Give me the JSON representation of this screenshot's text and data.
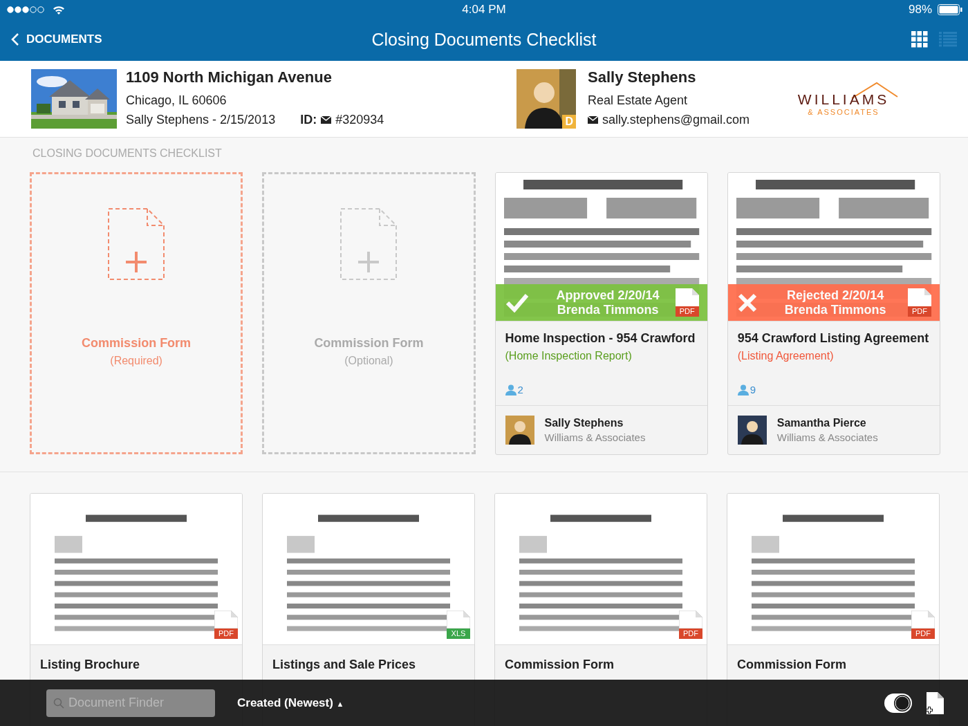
{
  "status_bar": {
    "time": "4:04 PM",
    "battery": "98%"
  },
  "nav": {
    "back": "DOCUMENTS",
    "title": "Closing Documents Checklist",
    "views": [
      {
        "kind": "grid",
        "selected": true
      },
      {
        "kind": "list",
        "selected": false
      }
    ]
  },
  "property": {
    "address": "1109 North Michigan Avenue",
    "city": "Chicago, IL 60606",
    "owner_date": "Sally Stephens - 2/15/2013",
    "id_label": "ID:",
    "id": "#320934"
  },
  "agent": {
    "name": "Sally Stephens",
    "role": "Real Estate Agent",
    "email": "sally.stephens@gmail.com",
    "badge": "D"
  },
  "logo": {
    "name": "WILLIAMS",
    "sub": "& ASSOCIATES"
  },
  "section_title": "CLOSING DOCUMENTS CHECKLIST",
  "checklist": [
    {
      "kind": "slot",
      "title": "Commission Form",
      "note": "(Required)",
      "required": true
    },
    {
      "kind": "slot",
      "title": "Commission Form",
      "note": "(Optional)",
      "required": false
    },
    {
      "kind": "document",
      "approved": true,
      "status_line": "Approved 2/20/14",
      "reviewer": "Brenda Timmons",
      "file": "PDF",
      "title": "Home Inspection - 954 Crawford",
      "category": "(Home Inspection Report)",
      "count": "2",
      "owner": "Sally Stephens",
      "company": "Williams & Associates"
    },
    {
      "kind": "document",
      "approved": false,
      "status_line": "Rejected 2/20/14",
      "reviewer": "Brenda Timmons",
      "file": "PDF",
      "title": "954 Crawford Listing Agreement",
      "category": "(Listing Agreement)",
      "count": "9",
      "owner": "Samantha Pierce",
      "company": "Williams & Associates"
    }
  ],
  "documents": [
    {
      "title": "Listing Brochure",
      "file": "PDF"
    },
    {
      "title": "Listings and Sale Prices",
      "file": "XLS"
    },
    {
      "title": "Commission Form",
      "file": "PDF"
    },
    {
      "title": "Commission Form",
      "file": "PDF"
    }
  ],
  "toolbar": {
    "search_placeholder": "Document Finder",
    "sort": "Created (Newest)",
    "sort_dir": "▲"
  }
}
